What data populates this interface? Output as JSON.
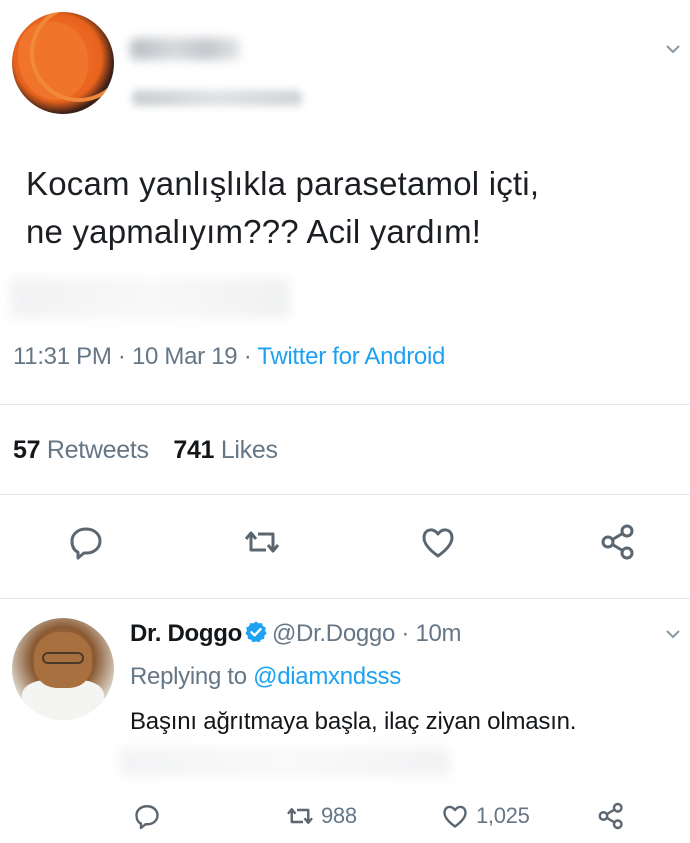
{
  "main_tweet": {
    "text": "Kocam yanlışlıkla parasetamol içti,\nne yapmalıyım??? Acil yardım!",
    "timestamp": "11:31 PM · 10 Mar 19 · ",
    "source": "Twitter for Android",
    "retweet_count": "57",
    "retweet_label": "Retweets",
    "like_count": "741",
    "like_label": "Likes",
    "icons": [
      "reply-icon",
      "retweet-icon",
      "like-icon",
      "share-icon"
    ]
  },
  "reply_tweet": {
    "name": "Dr. Doggo",
    "handle": "@Dr.Doggo",
    "time": " · 10m",
    "replying_label": "Replying to ",
    "replying_to": "@diamxndsss",
    "text": "Başını ağrıtmaya başla, ilaç ziyan olmasın.",
    "retweet_count": "988",
    "like_count": "1,025"
  },
  "colors": {
    "accent": "#1da1f2",
    "secondary_text": "#657786",
    "divider": "#e1e8ed",
    "icon_gray": "#5b6670"
  }
}
